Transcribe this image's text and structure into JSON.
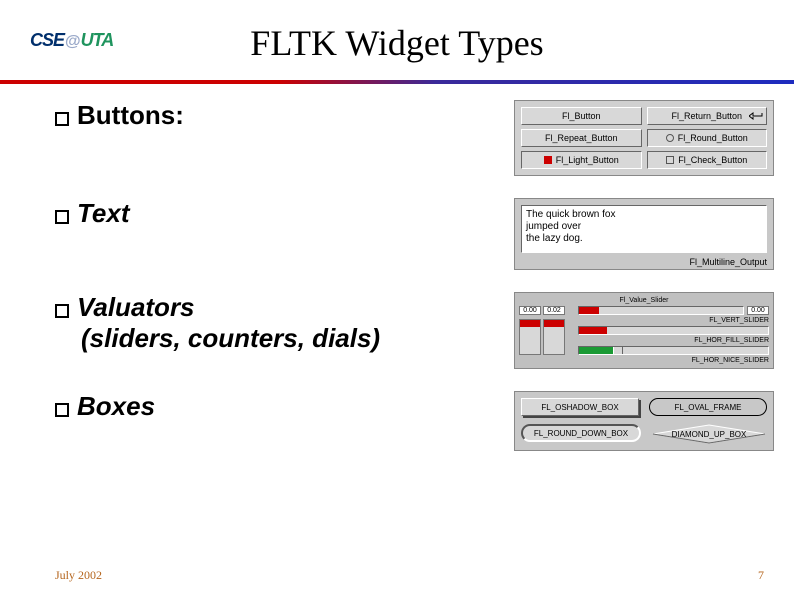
{
  "logo": {
    "cse": "CSE",
    "at": "@",
    "uta": "UTA"
  },
  "title": "FLTK Widget Types",
  "bullets": {
    "buttons": "Buttons:",
    "text": "Text",
    "valuators": "Valuators",
    "valuators_cont": "(sliders, counters, dials)",
    "boxes": "Boxes"
  },
  "buttons_panel": {
    "fl_button": "Fl_Button",
    "fl_return_button": "Fl_Return_Button",
    "fl_repeat_button": "Fl_Repeat_Button",
    "fl_round_button": "Fl_Round_Button",
    "fl_light_button": "Fl_Light_Button",
    "fl_check_button": "Fl_Check_Button"
  },
  "text_panel": {
    "sample": "The quick brown fox\njumped over\nthe lazy dog.",
    "caption": "Fl_Multiline_Output"
  },
  "valuators_panel": {
    "title": "Fl_Value_Slider",
    "val_a": "0.00",
    "val_b": "0.02",
    "val_c": "0.00",
    "label_hor_fill": "FL_HOR_FILL_SLIDER",
    "label_hor_nice": "FL_HOR_NICE_SLIDER",
    "label_vert": "FL_VERT_SLIDER"
  },
  "boxes_panel": {
    "oshadow": "FL_OSHADOW_BOX",
    "oval_frame": "FL_OVAL_FRAME",
    "round_down": "FL_ROUND_DOWN_BOX",
    "diamond_up": "DIAMOND_UP_BOX"
  },
  "footer": {
    "date": "July 2002",
    "page": "7"
  }
}
